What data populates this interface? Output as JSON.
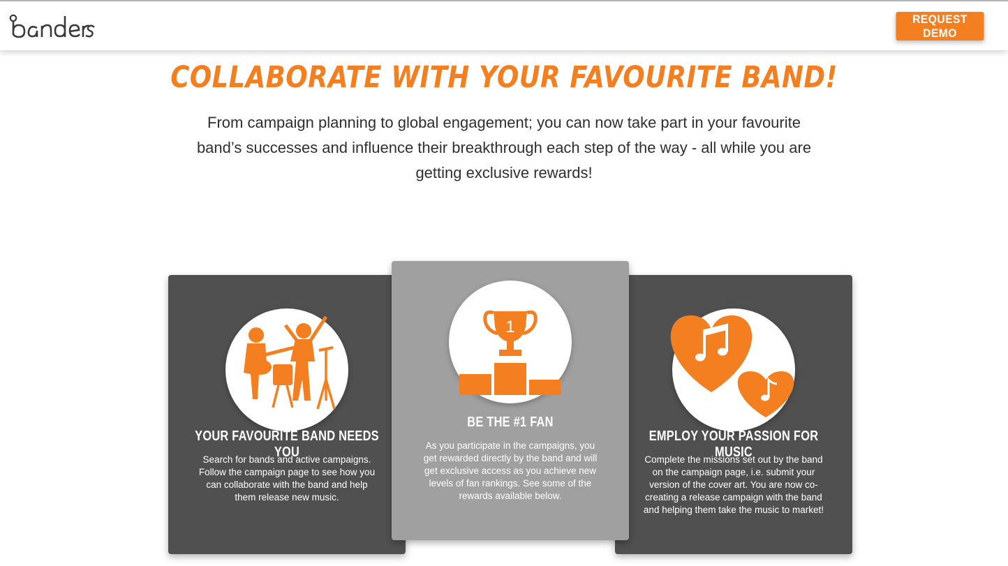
{
  "header": {
    "logo_text": "banders",
    "cta_label": "REQUEST DEMO"
  },
  "hero": {
    "headline": "COLLABORATE WITH YOUR FAVOURITE BAND!",
    "intro": "From campaign planning to global engagement; you can now take part in your favourite band’s successes and influence their breakthrough each step of the way - all while you are getting exclusive rewards!"
  },
  "cards": [
    {
      "icon": "band-icon",
      "title": "YOUR FAVOURITE BAND NEEDS YOU",
      "text": "Search for bands and active campaigns. Follow the campaign page to see how you can collaborate with the band and help them release new music."
    },
    {
      "icon": "trophy-podium-icon",
      "trophy_number": "1",
      "title": "BE THE #1 FAN",
      "text": "As you participate in the campaigns, you get rewarded directly by the band and will get exclusive access as you achieve new levels of fan rankings. See some of the rewards available below."
    },
    {
      "icon": "music-hearts-icon",
      "title": "EMPLOY YOUR PASSION FOR MUSIC",
      "text": "Complete the missions set out by the band on the campaign page, i.e. submit your version of the cover art. You are now co-creating a release campaign with the band and helping them take the music to market!"
    }
  ],
  "colors": {
    "accent": "#f47f20",
    "card_dark": "#505050",
    "card_light": "#a0a0a0",
    "text": "#2f2f2f"
  }
}
